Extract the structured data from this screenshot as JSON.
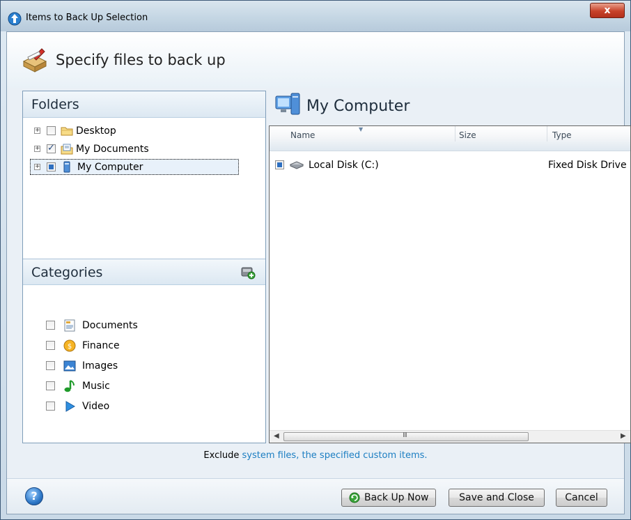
{
  "window": {
    "title": "Items to Back Up Selection",
    "close_label": "x"
  },
  "header": {
    "title": "Specify files to back up"
  },
  "folders": {
    "heading": "Folders",
    "items": [
      {
        "label": "Desktop",
        "state": "unchecked",
        "icon": "folder-icon"
      },
      {
        "label": "My Documents",
        "state": "checked",
        "icon": "documents-folder-icon"
      },
      {
        "label": "My Computer",
        "state": "partial",
        "icon": "computer-icon",
        "selected": true
      }
    ]
  },
  "categories": {
    "heading": "Categories",
    "items": [
      {
        "label": "Documents",
        "icon": "document-icon"
      },
      {
        "label": "Finance",
        "icon": "finance-coin-icon"
      },
      {
        "label": "Images",
        "icon": "image-icon"
      },
      {
        "label": "Music",
        "icon": "music-note-icon"
      },
      {
        "label": "Video",
        "icon": "video-play-icon"
      }
    ]
  },
  "content": {
    "title": "My Computer",
    "columns": {
      "name": "Name",
      "size": "Size",
      "type": "Type"
    },
    "rows": [
      {
        "name": "Local Disk (C:)",
        "size": "",
        "type": "Fixed Disk Drive",
        "state": "partial"
      }
    ],
    "scroll_grip": "III"
  },
  "exclude": {
    "prefix": "Exclude",
    "link": "system files, the specified custom items."
  },
  "footer": {
    "help_label": "?",
    "backup_label": "Back Up Now",
    "save_label": "Save and Close",
    "cancel_label": "Cancel"
  },
  "colors": {
    "link": "#1c7ec2",
    "accent": "#2d6fc0"
  }
}
